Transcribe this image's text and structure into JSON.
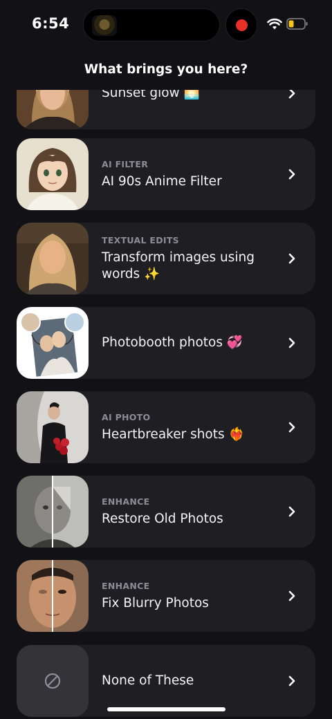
{
  "status_bar": {
    "time": "6:54",
    "wifi_icon": "wifi-icon",
    "battery_icon": "battery-low-icon"
  },
  "header": {
    "title": "What brings you here?"
  },
  "items": [
    {
      "category": "",
      "title": "Sunset glow 🌅",
      "thumb": "sunset-portrait"
    },
    {
      "category": "AI FILTER",
      "title": "AI 90s Anime Filter",
      "thumb": "anime-portrait"
    },
    {
      "category": "TEXTUAL EDITS",
      "title": "Transform images using words ✨",
      "thumb": "car-selfie-portrait"
    },
    {
      "category": "",
      "title": "Photobooth photos 💞",
      "thumb": "photobooth-collage"
    },
    {
      "category": "AI PHOTO",
      "title": "Heartbreaker shots ❤️‍🔥",
      "thumb": "suit-roses-portrait"
    },
    {
      "category": "ENHANCE",
      "title": "Restore Old Photos",
      "thumb": "old-photo-split"
    },
    {
      "category": "ENHANCE",
      "title": "Fix Blurry Photos",
      "thumb": "blurry-face-split"
    },
    {
      "category": "",
      "title": "None of These",
      "thumb": "none-icon"
    }
  ],
  "colors": {
    "background": "#121216",
    "card": "#1f1f23",
    "category": "#8c8c92",
    "record": "#e8302b",
    "battery": "#f5c518"
  }
}
